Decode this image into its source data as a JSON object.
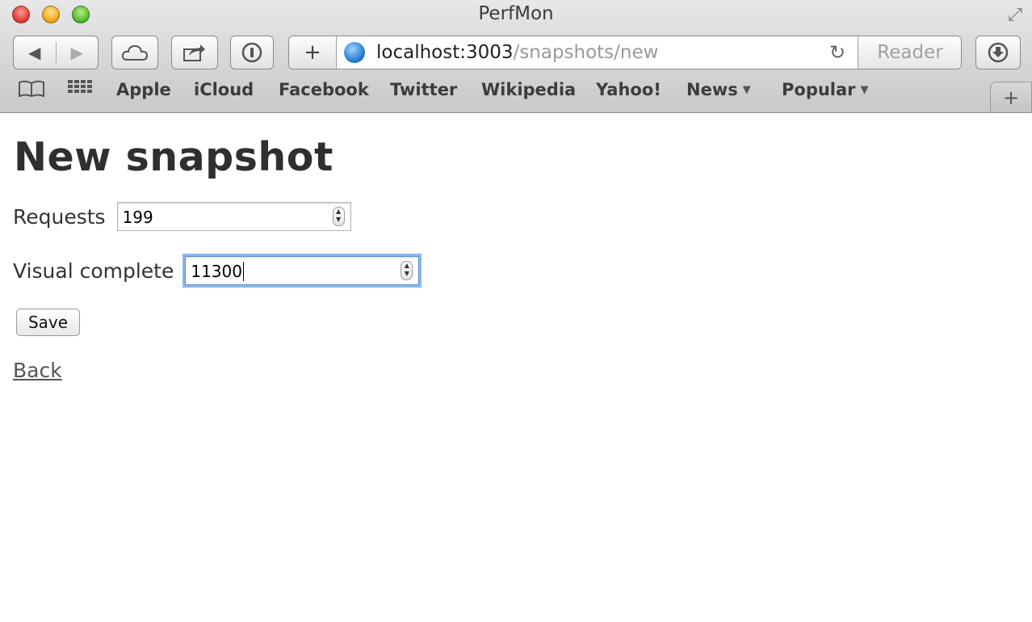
{
  "window": {
    "title": "PerfMon"
  },
  "toolbar": {
    "back_icon": "back-arrow-icon",
    "forward_icon": "forward-arrow-icon",
    "icloud_icon": "cloud-icon",
    "share_icon": "share-icon",
    "onepassword_icon": "onepassword-icon",
    "new_tab_plus": "+",
    "reader_label": "Reader",
    "download_icon": "download-icon"
  },
  "address": {
    "host": "localhost:3003",
    "path": "/snapshots/new"
  },
  "bookmarks": {
    "items": [
      "Apple",
      "iCloud",
      "Facebook",
      "Twitter",
      "Wikipedia",
      "Yahoo!",
      "News",
      "Popular"
    ]
  },
  "page": {
    "heading": "New snapshot",
    "requests": {
      "label": "Requests",
      "value": "199"
    },
    "visual_complete": {
      "label": "Visual complete",
      "value": "11300"
    },
    "save_label": "Save",
    "back_label": "Back"
  },
  "colors": {
    "focus_ring": "#8fb6ea",
    "heading": "#2f2f2f"
  }
}
